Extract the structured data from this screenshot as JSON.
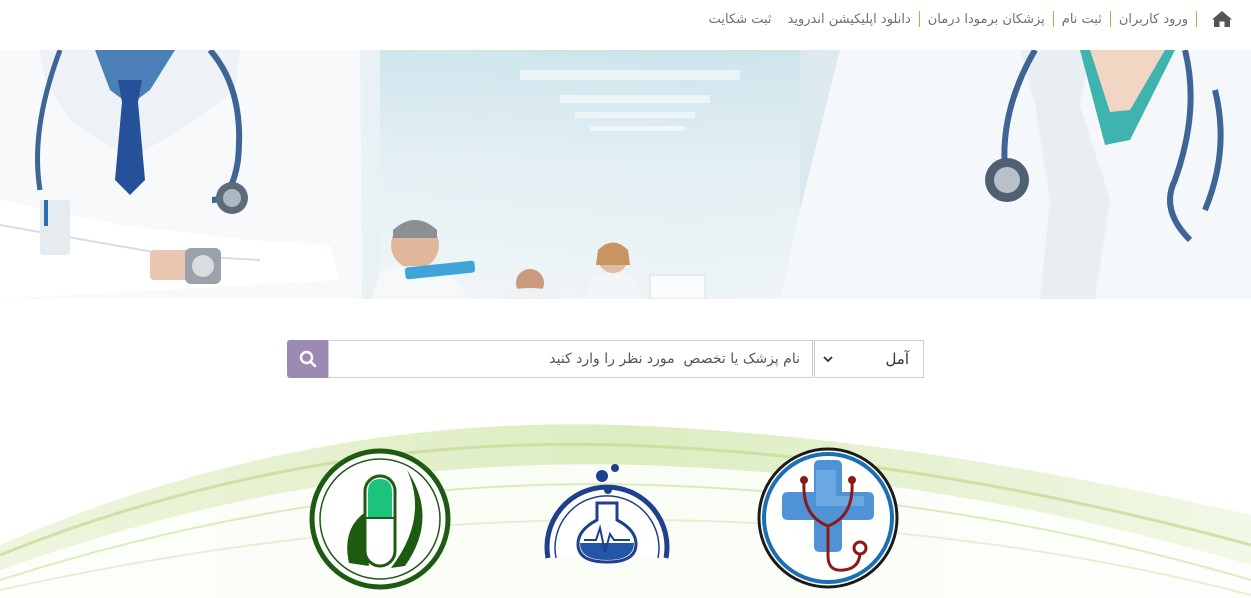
{
  "nav": {
    "home_icon": "home-icon",
    "items": [
      {
        "label": "ورود کاربران"
      },
      {
        "label": "ثبت نام"
      },
      {
        "label": "پزشکان برمودا درمان"
      },
      {
        "label": "دانلود اپلیکیشن اندروید"
      },
      {
        "label": "ثبت شکایت"
      }
    ],
    "separator_color": "#c9a44a"
  },
  "search": {
    "placeholder": "نام پزشک یا تخصص  مورد نظر را وارد کنید",
    "value": "",
    "city_selected": "آمل",
    "button_icon": "search-icon",
    "button_color": "#9b8bb4"
  },
  "features": [
    {
      "icon": "medical-cross-stethoscope-icon",
      "color": "#1b6fb5"
    },
    {
      "icon": "lab-flask-icon",
      "color": "#1f3f8f"
    },
    {
      "icon": "herbal-capsule-icon",
      "color": "#1d5a12"
    }
  ]
}
